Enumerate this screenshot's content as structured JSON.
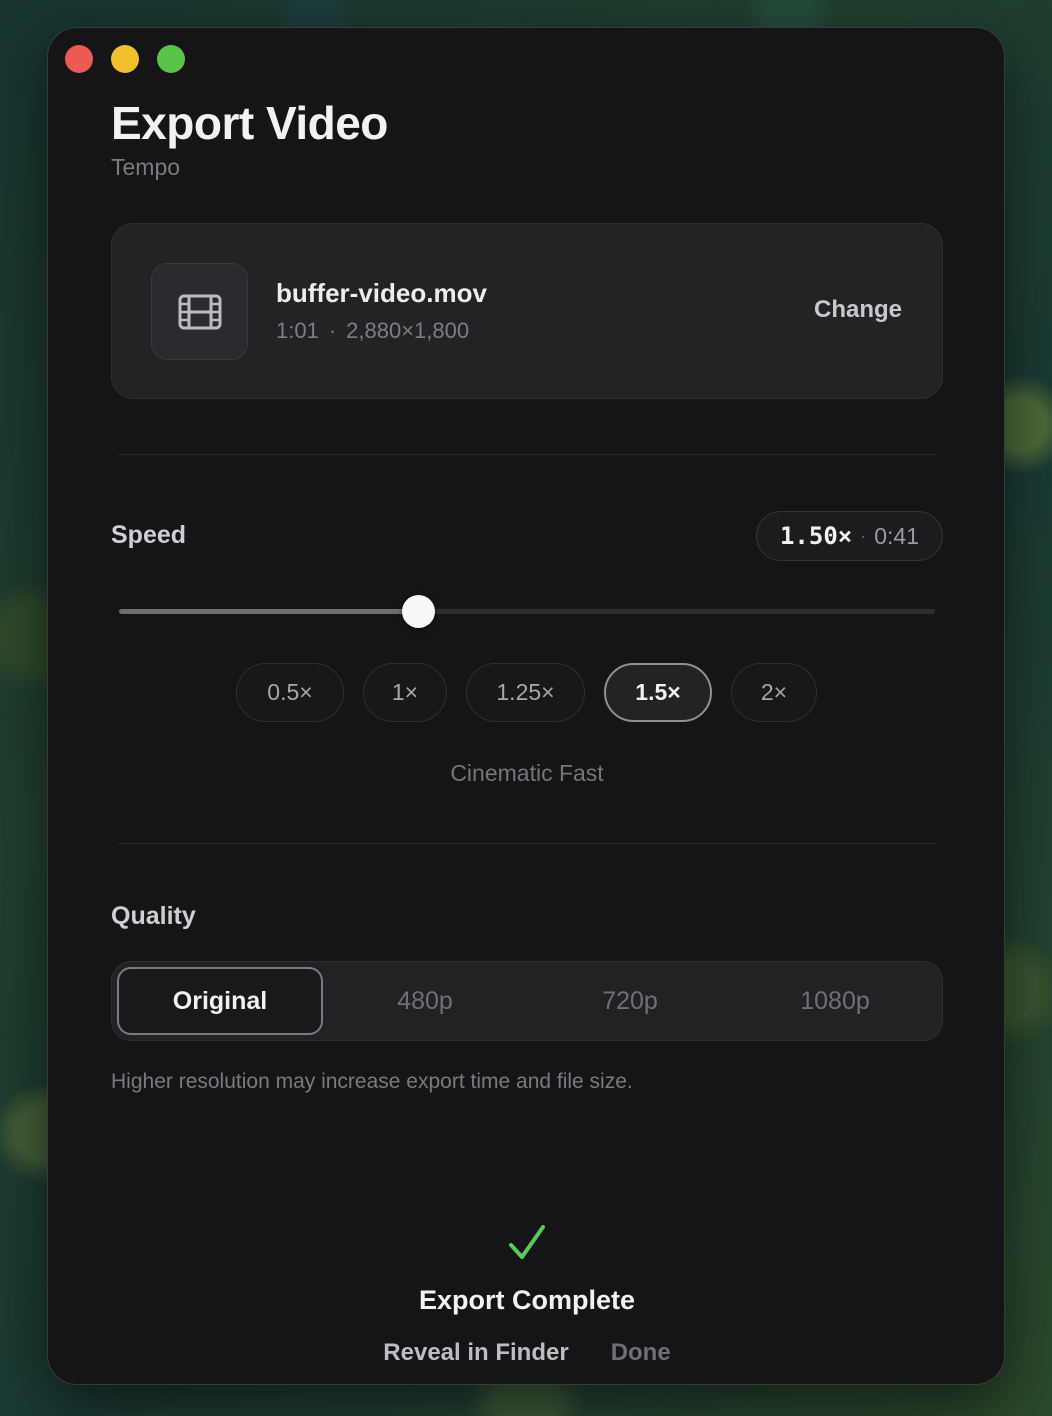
{
  "window": {
    "title": "Export Video",
    "subtitle": "Tempo"
  },
  "file": {
    "name": "buffer-video.mov",
    "duration": "1:01",
    "separator": "·",
    "resolution": "2,880×1,800",
    "change_label": "Change",
    "icon": "film-icon"
  },
  "speed": {
    "label": "Speed",
    "value_display": "1.50×",
    "dot": "·",
    "resulting_duration": "0:41",
    "slider_fraction": 0.366,
    "presets": [
      {
        "label": "0.5×",
        "active": false
      },
      {
        "label": "1×",
        "active": false
      },
      {
        "label": "1.25×",
        "active": false
      },
      {
        "label": "1.5×",
        "active": true
      },
      {
        "label": "2×",
        "active": false
      }
    ],
    "description": "Cinematic Fast"
  },
  "quality": {
    "label": "Quality",
    "options": [
      {
        "label": "Original",
        "active": true
      },
      {
        "label": "480p",
        "active": false
      },
      {
        "label": "720p",
        "active": false
      },
      {
        "label": "1080p",
        "active": false
      }
    ],
    "hint": "Higher resolution may increase export time and file size."
  },
  "status": {
    "icon": "checkmark-icon",
    "title": "Export Complete",
    "reveal_label": "Reveal in Finder",
    "done_label": "Done"
  },
  "colors": {
    "close": "#ed5a54",
    "minimize": "#f3be2e",
    "zoom": "#5ac34a",
    "success": "#5ac95a"
  }
}
